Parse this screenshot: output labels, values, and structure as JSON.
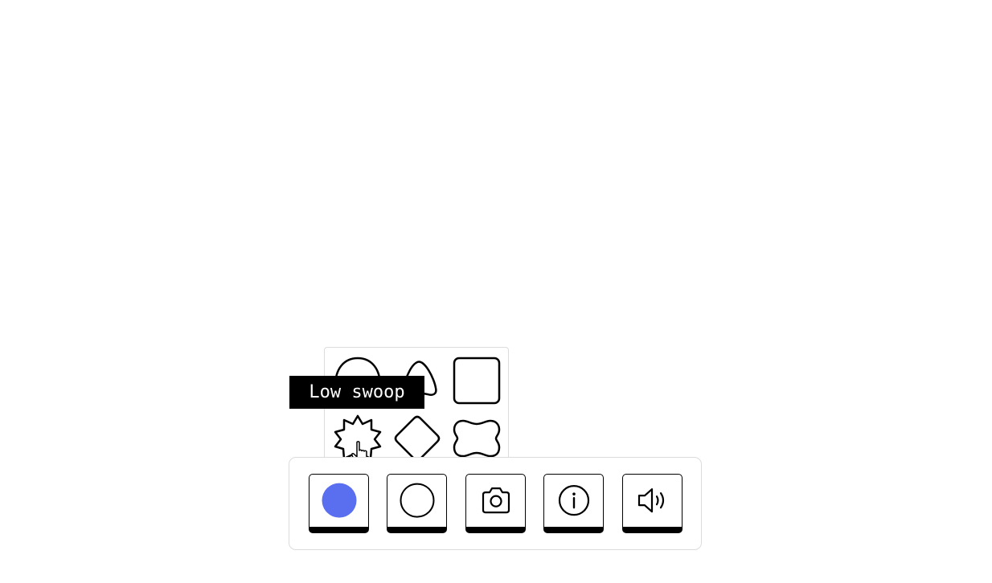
{
  "tooltip": {
    "text": "Low swoop"
  },
  "shape_picker": {
    "shapes": [
      {
        "name": "semicircle-shape-icon"
      },
      {
        "name": "swoop-triangle-shape-icon"
      },
      {
        "name": "rounded-square-shape-icon"
      },
      {
        "name": "starburst-shape-icon"
      },
      {
        "name": "rounded-diamond-shape-icon"
      },
      {
        "name": "pill-notch-shape-icon"
      }
    ]
  },
  "toolbar": {
    "buttons": [
      {
        "icon": "color-dot-icon",
        "color": "#5a6ff0"
      },
      {
        "icon": "circle-shape-icon"
      },
      {
        "icon": "camera-icon"
      },
      {
        "icon": "info-icon"
      },
      {
        "icon": "speaker-icon"
      }
    ]
  },
  "colors": {
    "accent": "#5a6ff0",
    "border": "#dcdcdc",
    "ink": "#000000"
  }
}
